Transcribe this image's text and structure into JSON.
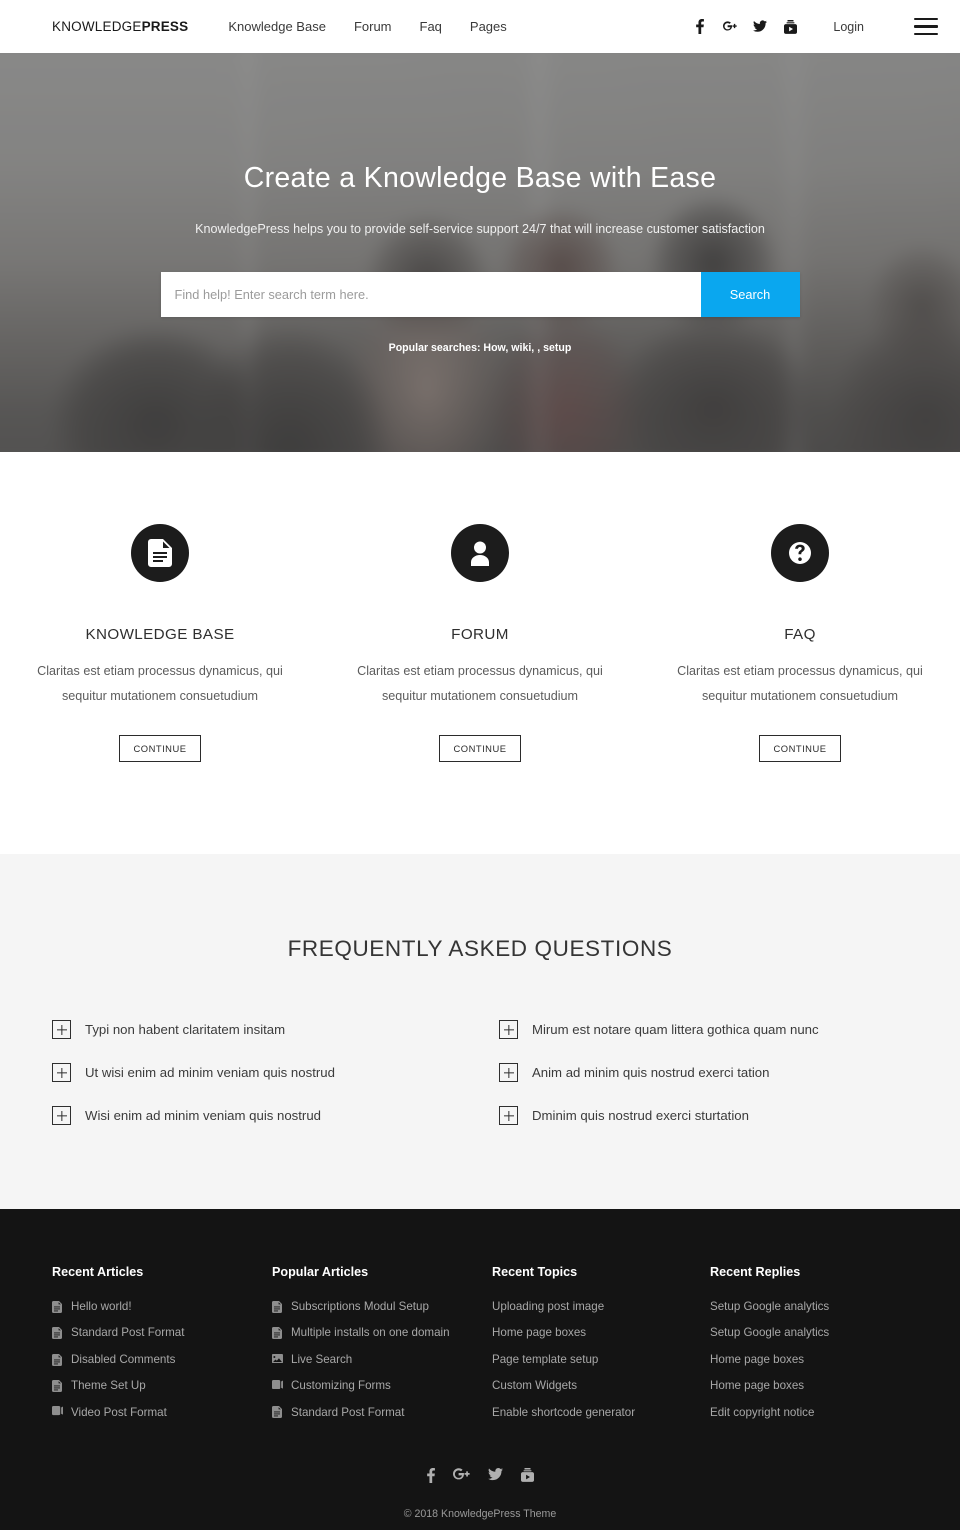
{
  "header": {
    "brand_light": "KNOWLEDGE",
    "brand_bold": "PRESS",
    "nav": [
      {
        "label": "Knowledge Base"
      },
      {
        "label": "Forum"
      },
      {
        "label": "Faq"
      },
      {
        "label": "Pages"
      }
    ],
    "social": [
      {
        "name": "facebook-icon",
        "label": "Facebook"
      },
      {
        "name": "google-plus-icon",
        "label": "Google Plus"
      },
      {
        "name": "twitter-icon",
        "label": "Twitter"
      },
      {
        "name": "youtube-icon",
        "label": "YouTube"
      }
    ],
    "login_label": "Login",
    "menu_toggle_label": "Menu"
  },
  "hero": {
    "title": "Create a Knowledge Base with Ease",
    "subtitle": "KnowledgePress helps you to provide self-service support 24/7 that will increase customer satisfaction",
    "search_placeholder": "Find help! Enter search term here.",
    "search_value": "",
    "search_button": "Search",
    "popular_searches": "Popular searches: How, wiki, , setup",
    "accent_color": "#0aa7ef",
    "overlay_color": "#5f5f5f"
  },
  "features": [
    {
      "icon": "document-icon",
      "title": "KNOWLEDGE BASE",
      "desc": "Claritas est etiam processus dynamicus, qui sequitur mutationem consuetudium",
      "button": "CONTINUE"
    },
    {
      "icon": "user-icon",
      "title": "FORUM",
      "desc": "Claritas est etiam processus dynamicus, qui sequitur mutationem consuetudium",
      "button": "CONTINUE"
    },
    {
      "icon": "question-mark-icon",
      "title": "FAQ",
      "desc": "Claritas est etiam processus dynamicus, qui sequitur mutationem consuetudium",
      "button": "CONTINUE"
    }
  ],
  "faq": {
    "heading": "FREQUENTLY ASKED QUESTIONS",
    "left": [
      {
        "question": "Typi non habent claritatem insitam"
      },
      {
        "question": "Ut wisi enim ad minim veniam quis nostrud"
      },
      {
        "question": "Wisi enim ad minim veniam quis nostrud"
      }
    ],
    "right": [
      {
        "question": "Mirum est notare quam littera gothica quam nunc"
      },
      {
        "question": "Anim ad minim quis nostrud exerci tation"
      },
      {
        "question": "Dminim quis nostrud exerci sturtation"
      }
    ]
  },
  "footer": {
    "columns": [
      {
        "title": "Recent Articles",
        "items": [
          {
            "label": "Hello world!",
            "icon": "document-icon"
          },
          {
            "label": "Standard Post Format",
            "icon": "document-icon"
          },
          {
            "label": "Disabled Comments",
            "icon": "document-icon"
          },
          {
            "label": "Theme Set Up",
            "icon": "document-icon"
          },
          {
            "label": "Video Post Format",
            "icon": "video-icon"
          }
        ]
      },
      {
        "title": "Popular Articles",
        "items": [
          {
            "label": "Subscriptions Modul Setup",
            "icon": "document-icon"
          },
          {
            "label": "Multiple installs on one domain",
            "icon": "document-icon"
          },
          {
            "label": "Live Search",
            "icon": "image-icon"
          },
          {
            "label": "Customizing Forms",
            "icon": "video-icon"
          },
          {
            "label": "Standard Post Format",
            "icon": "document-icon"
          }
        ]
      },
      {
        "title": "Recent Topics",
        "items": [
          {
            "label": "Uploading post image",
            "icon": ""
          },
          {
            "label": "Home page boxes",
            "icon": ""
          },
          {
            "label": "Page template setup",
            "icon": ""
          },
          {
            "label": "Custom Widgets",
            "icon": ""
          },
          {
            "label": "Enable shortcode generator",
            "icon": ""
          }
        ]
      },
      {
        "title": "Recent Replies",
        "items": [
          {
            "label": "Setup Google analytics",
            "icon": ""
          },
          {
            "label": "Setup Google analytics",
            "icon": ""
          },
          {
            "label": "Home page boxes",
            "icon": ""
          },
          {
            "label": "Home page boxes",
            "icon": ""
          },
          {
            "label": "Edit copyright notice",
            "icon": ""
          }
        ]
      }
    ],
    "social": [
      {
        "name": "facebook-icon",
        "label": "Facebook"
      },
      {
        "name": "google-plus-icon",
        "label": "Google Plus"
      },
      {
        "name": "twitter-icon",
        "label": "Twitter"
      },
      {
        "name": "youtube-icon",
        "label": "YouTube"
      }
    ],
    "copyright": "© 2018 KnowledgePress Theme"
  }
}
